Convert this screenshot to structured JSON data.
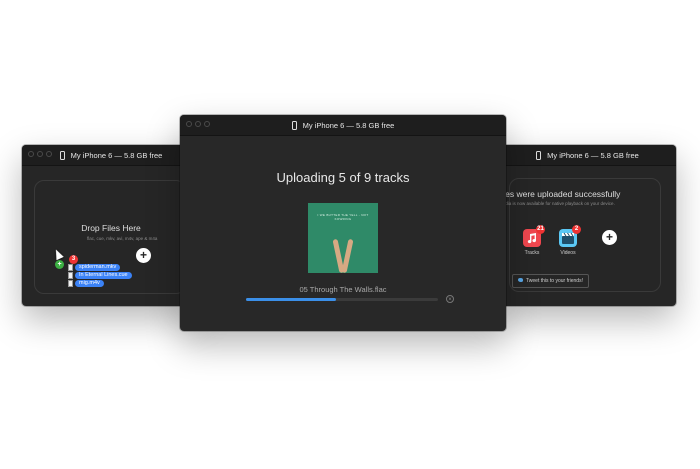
{
  "left_window": {
    "title": "My iPhone 6 — 5.8 GB free",
    "drop_title": "Drop Files Here",
    "drop_subtitle": "flac, cue, mkv, avi, m4v, ape & m4a",
    "files": [
      "spiderman.mkv",
      "In Eternal Lines.cue",
      "mig.m4v"
    ],
    "file_badge": "3"
  },
  "center_window": {
    "title": "My iPhone 6 — 5.8 GB free",
    "status": "Uploading 5 of 9 tracks",
    "album_art_text": "I WE BUTTER THE YELL - NOT KOWRING",
    "track_name": "05 Through The Walls.flac",
    "progress": 0.47
  },
  "right_window": {
    "title": "My iPhone 6 — 5.8 GB free",
    "success_title": "files were uploaded successfully",
    "success_subtitle": "Media is now available for native playback on your device.",
    "apps": [
      {
        "label": "Tracks",
        "badge": "21",
        "icon": "music-app-icon",
        "color": "#f0474f"
      },
      {
        "label": "Videos",
        "badge": "2",
        "icon": "videos-app-icon",
        "color": "#5bc8f5"
      }
    ],
    "tweet_label": "Tweet this to your friends!"
  },
  "colors": {
    "accent": "#3b8fe8",
    "window_bg": "#262626",
    "album_bg": "#2f8a68",
    "badge_red": "#e33333",
    "badge_green": "#3cb043"
  }
}
